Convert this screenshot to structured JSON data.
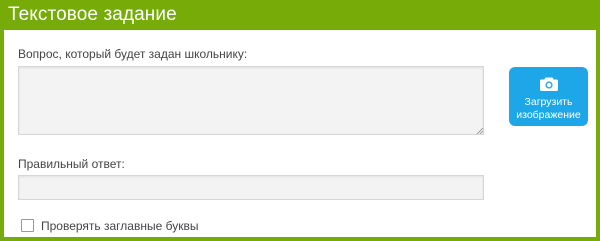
{
  "panel": {
    "title": "Текстовое задание"
  },
  "question": {
    "label": "Вопрос, который будет задан школьнику:",
    "value": "",
    "placeholder": ""
  },
  "upload": {
    "icon": "camera-icon",
    "label": "Загрузить\nизображение"
  },
  "answer": {
    "label": "Правильный ответ:",
    "value": "",
    "placeholder": ""
  },
  "case_check": {
    "label": "Проверять заглавные буквы",
    "checked": false
  },
  "colors": {
    "accent": "#77ab07",
    "button": "#1ea7e8",
    "input_bg": "#f3f3f3"
  }
}
